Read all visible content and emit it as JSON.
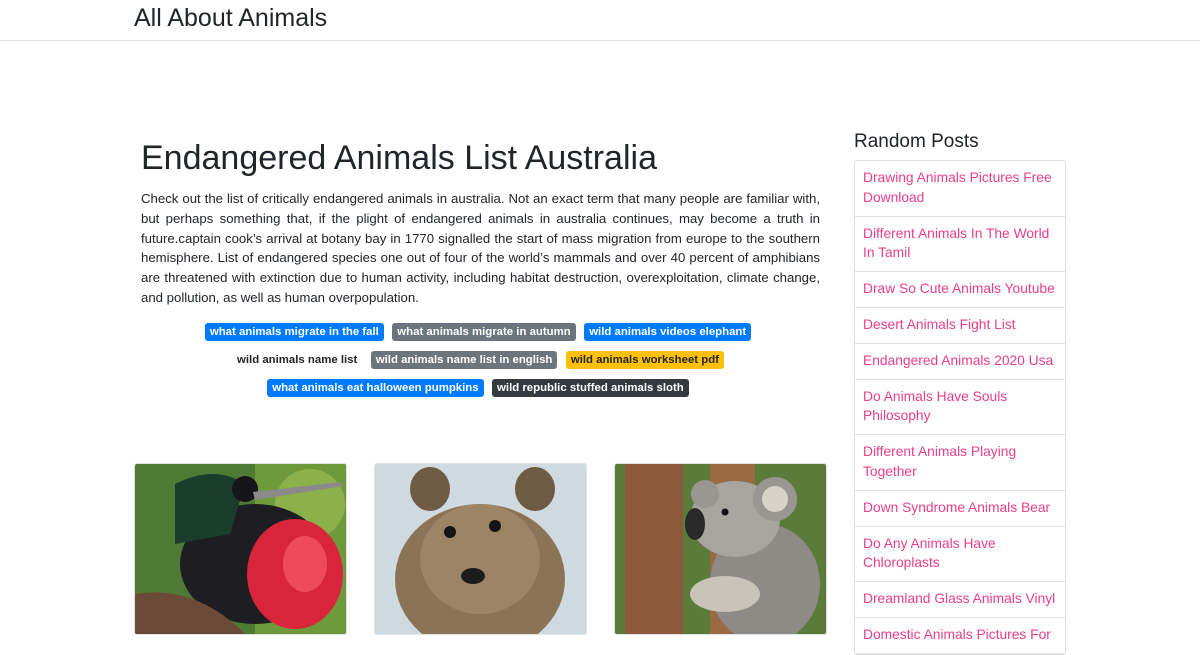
{
  "site": {
    "brand": "All About Animals"
  },
  "article": {
    "title": "Endangered Animals List Australia",
    "intro": "Check out the list of critically endangered animals in australia. Not an exact term that many people are familiar with, but perhaps something that, if the plight of endangered animals in australia continues, may become a truth in future.captain cook’s arrival at botany bay in 1770 signalled the start of mass migration from europe to the southern hemisphere. List of endangered species one out of four of the world’s mammals and over 40 percent of amphibians are threatened with extinction due to human activity, including habitat destruction, overexploitation, climate change, and pollution, as well as human overpopulation."
  },
  "tags": [
    {
      "label": "what animals migrate in the fall",
      "style": "primary"
    },
    {
      "label": "what animals migrate in autumn",
      "style": "secondary"
    },
    {
      "label": "wild animals videos elephant",
      "style": "primary"
    },
    {
      "label": "wild animals name list",
      "style": "light"
    },
    {
      "label": "wild animals name list in english",
      "style": "secondary"
    },
    {
      "label": "wild animals worksheet pdf",
      "style": "warning"
    },
    {
      "label": "what animals eat halloween pumpkins",
      "style": "primary"
    },
    {
      "label": "wild republic stuffed animals sloth",
      "style": "dark"
    }
  ],
  "thumbnails": [
    {
      "subject": "frigatebird"
    },
    {
      "subject": "quokka"
    },
    {
      "subject": "koala"
    }
  ],
  "sidebar": {
    "heading": "Random Posts",
    "posts": [
      "Drawing Animals Pictures Free Download",
      "Different Animals In The World In Tamil",
      "Draw So Cute Animals Youtube",
      "Desert Animals Fight List",
      "Endangered Animals 2020 Usa",
      "Do Animals Have Souls Philosophy",
      "Different Animals Playing Together",
      "Down Syndrome Animals Bear",
      "Do Any Animals Have Chloroplasts",
      "Dreamland Glass Animals Vinyl",
      "Domestic Animals Pictures For"
    ]
  },
  "colors": {
    "primary": "#007bff",
    "secondary": "#6c757d",
    "warning": "#ffc107",
    "dark": "#343a40",
    "link": "#e83e8c"
  }
}
